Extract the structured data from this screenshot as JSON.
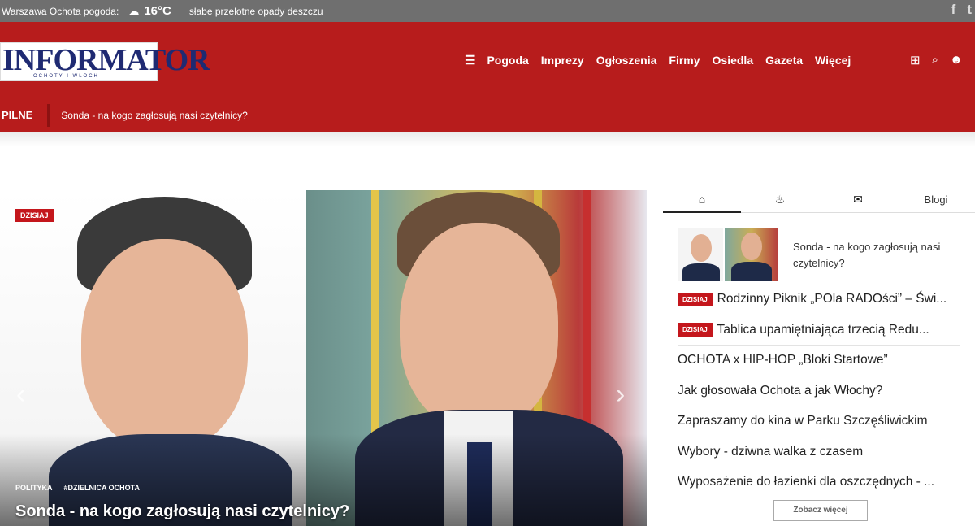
{
  "topbar": {
    "city": "Warszawa Ochota pogoda:",
    "weather_icon": "cloud-rain-icon",
    "temperature": "16°C",
    "description": "słabe przelotne opady deszczu",
    "social": [
      "f",
      "t"
    ]
  },
  "header": {
    "logo_text": "INFORMATOR",
    "logo_tagline": "OCHOTY I WŁOCH",
    "nav": [
      "Pogoda",
      "Imprezy",
      "Ogłoszenia",
      "Firmy",
      "Osiedla",
      "Gazeta",
      "Więcej"
    ],
    "breaking_label": "PILNE",
    "breaking_headline": "Sonda - na kogo zagłosują nasi czytelnicy?"
  },
  "hero": {
    "badge": "DZISIAJ",
    "tags": [
      "POLITYKA",
      "#DZIELNICA OCHOTA"
    ],
    "title": "Sonda - na kogo zagłosują nasi czytelnicy?",
    "prev_arrow": "‹",
    "next_arrow": "›"
  },
  "sidebar": {
    "tabs": [
      "home-icon",
      "fire-icon",
      "comment-icon"
    ],
    "blog_tab": "Blogi",
    "featured_title": "Sonda - na kogo zagłosują nasi czytelnicy?",
    "items": [
      {
        "pill": "DZISIAJ",
        "text": "Rodzinny Piknik „POla RADOści” – Świ..."
      },
      {
        "pill": "DZISIAJ",
        "text": "Tablica upamiętniająca trzecią Redu..."
      },
      {
        "pill": "",
        "text": "OCHOTA x HIP-HOP „Bloki Startowe”"
      },
      {
        "pill": "",
        "text": "Jak głosowała Ochota a jak Włochy?"
      },
      {
        "pill": "",
        "text": "Zapraszamy do kina w Parku Szczęśliwickim"
      },
      {
        "pill": "",
        "text": "Wybory - dziwna walka z czasem"
      },
      {
        "pill": "",
        "text": "Wyposażenie do łazienki dla oszczędnych - ..."
      }
    ],
    "more_button": "Zobacz więcej"
  },
  "colors": {
    "header_red": "#b71c1c",
    "badge_red": "#c4161c",
    "topbar_gray": "#6f6f6f",
    "logo_blue": "#1f2a72"
  }
}
